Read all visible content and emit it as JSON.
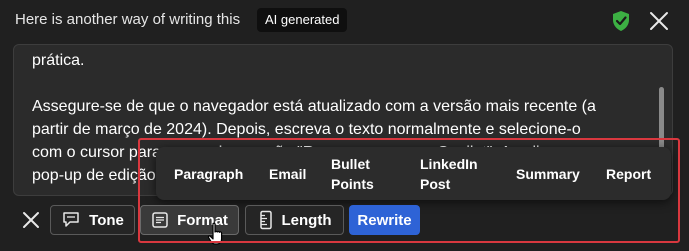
{
  "header": {
    "title": "Here is another way of writing this",
    "badge": "AI generated",
    "shield_icon": "shield-check-icon",
    "shield_color": "#3cb043",
    "close_icon": "close-icon"
  },
  "content": {
    "lines": [
      "prática.",
      "",
      "Assegure-se de que o navegador está atualizado com a versão mais recente (a",
      "partir de março de 2024). Depois, escreva o texto normalmente e selecione-o",
      "com o cursor para que surja a opção \"Reescrever com o Copilot\". Ao clicar, um",
      "pop-up de edição"
    ]
  },
  "format_options": {
    "paragraph": "Paragraph",
    "email": "Email",
    "bullet_points": "Bullet Points",
    "linkedin_post": "LinkedIn Post",
    "summary": "Summary",
    "report": "Report"
  },
  "toolbar": {
    "close_icon": "close-icon",
    "tone_label": "Tone",
    "tone_icon": "speech-bubble-icon",
    "format_label": "Format",
    "format_icon": "text-document-icon",
    "length_label": "Length",
    "length_icon": "ruler-icon",
    "rewrite_label": "Rewrite",
    "rewrite_color": "#2e63d6"
  },
  "colors": {
    "background": "#202020",
    "highlight": "#d9383f"
  }
}
